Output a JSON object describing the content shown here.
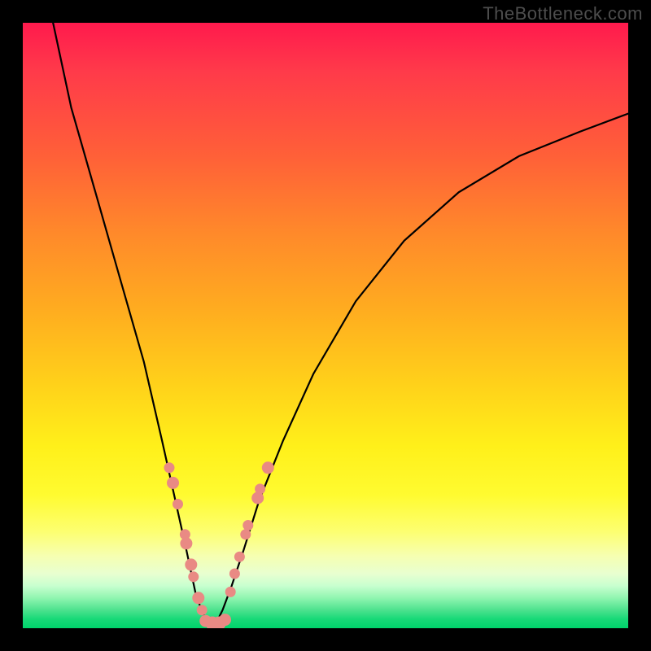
{
  "watermark": "TheBottleneck.com",
  "chart_data": {
    "type": "line",
    "title": "",
    "xlabel": "",
    "ylabel": "",
    "xlim": [
      0,
      100
    ],
    "ylim": [
      0,
      100
    ],
    "curve_left": {
      "x": [
        5,
        8,
        12,
        16,
        20,
        23,
        25,
        27,
        28.5,
        29.5,
        30.5,
        31
      ],
      "y": [
        100,
        86,
        72,
        58,
        44,
        31,
        22,
        13,
        6,
        3,
        1,
        0
      ]
    },
    "curve_right": {
      "x": [
        31,
        32,
        33,
        34.5,
        36.5,
        39,
        43,
        48,
        55,
        63,
        72,
        82,
        92,
        100
      ],
      "y": [
        0,
        1,
        3,
        7,
        13,
        21,
        31,
        42,
        54,
        64,
        72,
        78,
        82,
        85
      ]
    },
    "floor": {
      "x": [
        29,
        35
      ],
      "y": [
        0,
        0
      ]
    },
    "series": [
      {
        "name": "left-cluster",
        "points": [
          {
            "x": 24.2,
            "y": 26.5,
            "r": 6
          },
          {
            "x": 24.8,
            "y": 24.0,
            "r": 7
          },
          {
            "x": 25.6,
            "y": 20.5,
            "r": 6
          },
          {
            "x": 26.8,
            "y": 15.5,
            "r": 6
          },
          {
            "x": 27.0,
            "y": 14.0,
            "r": 7
          },
          {
            "x": 27.8,
            "y": 10.5,
            "r": 7
          },
          {
            "x": 28.2,
            "y": 8.5,
            "r": 6
          },
          {
            "x": 29.0,
            "y": 5.0,
            "r": 7
          },
          {
            "x": 29.6,
            "y": 3.0,
            "r": 6
          }
        ]
      },
      {
        "name": "bottom-cluster",
        "points": [
          {
            "x": 30.2,
            "y": 1.2,
            "r": 7
          },
          {
            "x": 31.3,
            "y": 0.8,
            "r": 8
          },
          {
            "x": 32.4,
            "y": 0.8,
            "r": 8
          },
          {
            "x": 33.4,
            "y": 1.4,
            "r": 7
          }
        ]
      },
      {
        "name": "right-cluster",
        "points": [
          {
            "x": 34.3,
            "y": 6.0,
            "r": 6
          },
          {
            "x": 35.0,
            "y": 9.0,
            "r": 6
          },
          {
            "x": 35.8,
            "y": 11.8,
            "r": 6
          },
          {
            "x": 36.8,
            "y": 15.5,
            "r": 6
          },
          {
            "x": 37.2,
            "y": 17.0,
            "r": 6
          },
          {
            "x": 38.8,
            "y": 21.5,
            "r": 7
          },
          {
            "x": 39.2,
            "y": 23.0,
            "r": 6
          },
          {
            "x": 40.5,
            "y": 26.5,
            "r": 7
          }
        ]
      }
    ]
  }
}
